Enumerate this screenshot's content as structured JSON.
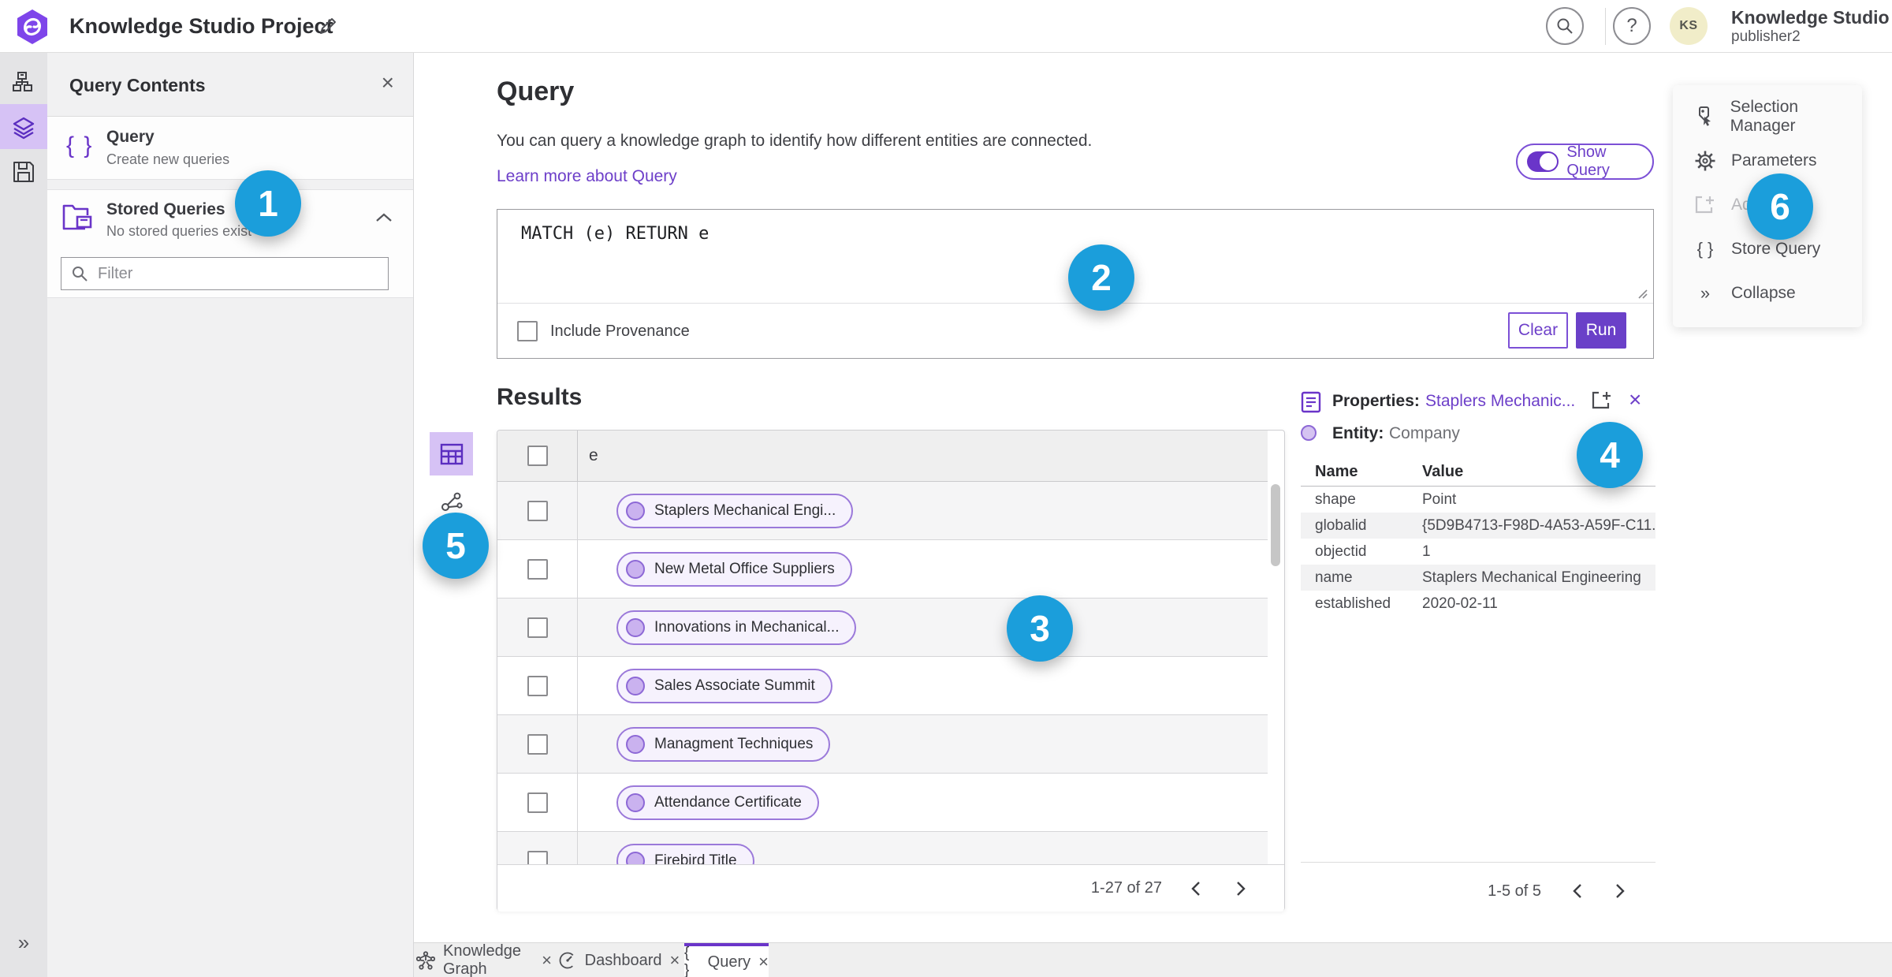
{
  "header": {
    "title": "Knowledge Studio Project",
    "user_name": "Knowledge Studio",
    "user_role": "publisher2",
    "avatar_initials": "KS",
    "help_glyph": "?"
  },
  "left_panel": {
    "title": "Query Contents",
    "close_glyph": "×",
    "items": [
      {
        "title": "Query",
        "subtitle": "Create new queries"
      },
      {
        "title": "Stored Queries",
        "subtitle": "No stored queries exist"
      }
    ],
    "filter_placeholder": "Filter",
    "braces_glyph": "{ }"
  },
  "rail": {
    "expand_glyph": "»"
  },
  "query_section": {
    "title": "Query",
    "description": "You can query a knowledge graph to identify how different entities are connected.",
    "learn_more": "Learn more about Query",
    "show_query_label": "Show Query",
    "query_text": "MATCH (e) RETURN e",
    "include_provenance_label": "Include Provenance",
    "clear_label": "Clear",
    "run_label": "Run"
  },
  "results": {
    "title": "Results",
    "column_header": "e",
    "rows": [
      "Staplers Mechanical Engi...",
      "New Metal Office Suppliers",
      "Innovations in Mechanical...",
      "Sales Associate Summit",
      "Managment Techniques",
      "Attendance Certificate",
      "Firebird Title"
    ],
    "pagination": "1-27 of 27"
  },
  "properties": {
    "title": "Properties:",
    "entity_link": "Staplers Mechanic...",
    "close_glyph": "×",
    "entity_label": "Entity:",
    "entity_type": "Company",
    "col_name": "Name",
    "col_value": "Value",
    "rows": [
      {
        "name": "shape",
        "value": "Point"
      },
      {
        "name": "globalid",
        "value": "{5D9B4713-F98D-4A53-A59F-C11..."
      },
      {
        "name": "objectid",
        "value": "1"
      },
      {
        "name": "name",
        "value": "Staplers Mechanical Engineering"
      },
      {
        "name": "established",
        "value": "2020-02-11"
      }
    ],
    "pagination": "1-5 of 5"
  },
  "right_menu": {
    "items": [
      {
        "label": "Selection Manager"
      },
      {
        "label": "Parameters"
      },
      {
        "label": "Add",
        "disabled": true
      },
      {
        "label": "Store Query"
      },
      {
        "label": "Collapse"
      }
    ],
    "braces_glyph": "{ }",
    "collapse_glyph": "»"
  },
  "tabs": [
    {
      "label": "Knowledge Graph",
      "close_glyph": "×"
    },
    {
      "label": "Dashboard",
      "close_glyph": "×"
    },
    {
      "label": "Query",
      "close_glyph": "×",
      "braces_glyph": "{ }"
    }
  ],
  "annotations": {
    "n1": "1",
    "n2": "2",
    "n3": "3",
    "n4": "4",
    "n5": "5",
    "n6": "6"
  },
  "colors": {
    "accent_purple": "#6a35c9",
    "link_purple": "#6d3fc9",
    "annotation_blue": "#1b9edb",
    "selected_rail_bg": "#d6c2f5",
    "chip_border": "#9b79da"
  }
}
